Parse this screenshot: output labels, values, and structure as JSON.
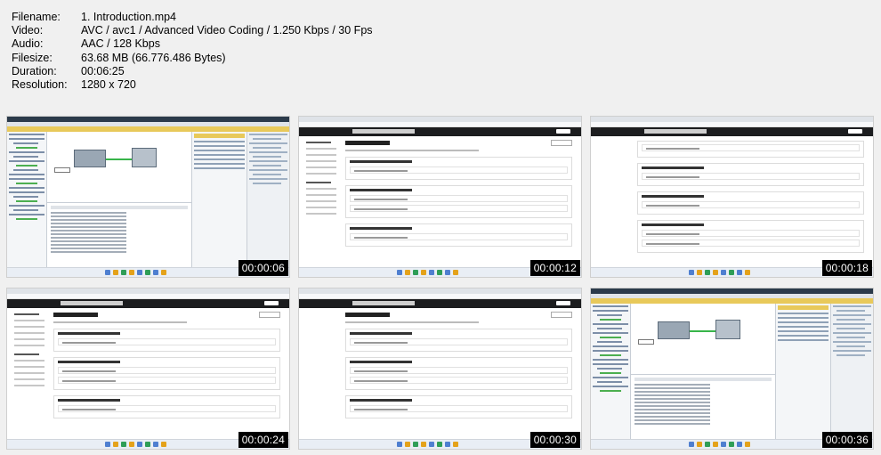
{
  "file_info": [
    {
      "label": "Filename:",
      "value": "1. Introduction.mp4"
    },
    {
      "label": "Video:",
      "value": "AVC / avc1 / Advanced Video Coding / 1.250 Kbps / 30 Fps"
    },
    {
      "label": "Audio:",
      "value": "AAC / 128 Kbps"
    },
    {
      "label": "Filesize:",
      "value": "63.68 MB (66.776.486 Bytes)"
    },
    {
      "label": "Duration:",
      "value": "00:06:25"
    },
    {
      "label": "Resolution:",
      "value": "1280 x 720"
    }
  ],
  "thumbnails": [
    {
      "timestamp": "00:00:06",
      "scene": "ide"
    },
    {
      "timestamp": "00:00:12",
      "scene": "course"
    },
    {
      "timestamp": "00:00:18",
      "scene": "course-scrolled"
    },
    {
      "timestamp": "00:00:24",
      "scene": "course"
    },
    {
      "timestamp": "00:00:30",
      "scene": "course"
    },
    {
      "timestamp": "00:00:36",
      "scene": "ide"
    }
  ]
}
